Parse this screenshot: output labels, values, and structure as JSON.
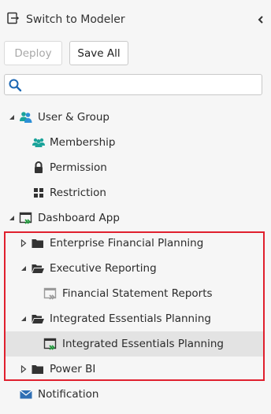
{
  "header": {
    "switch_label": "Switch to Modeler"
  },
  "toolbar": {
    "deploy_label": "Deploy",
    "save_all_label": "Save All"
  },
  "search": {
    "placeholder": "",
    "value": ""
  },
  "tree": {
    "user_group": {
      "label": "User & Group",
      "children": {
        "membership": "Membership",
        "permission": "Permission",
        "restriction": "Restriction"
      }
    },
    "dashboard_app": {
      "label": "Dashboard App",
      "children": {
        "enterprise_financial_planning": "Enterprise Financial Planning",
        "executive_reporting": "Executive Reporting",
        "financial_statement_reports": "Financial Statement Reports",
        "integrated_essentials_planning_folder": "Integrated Essentials Planning",
        "integrated_essentials_planning_dashboard": "Integrated Essentials Planning",
        "power_bi": "Power BI"
      }
    },
    "notification": {
      "label": "Notification"
    }
  },
  "colors": {
    "accent_teal": "#1aa39a",
    "accent_blue": "#2d8fd6",
    "highlight_red": "#e0202e",
    "selected_bg": "#e3e3e3",
    "envelope_blue": "#2f6fb4"
  }
}
